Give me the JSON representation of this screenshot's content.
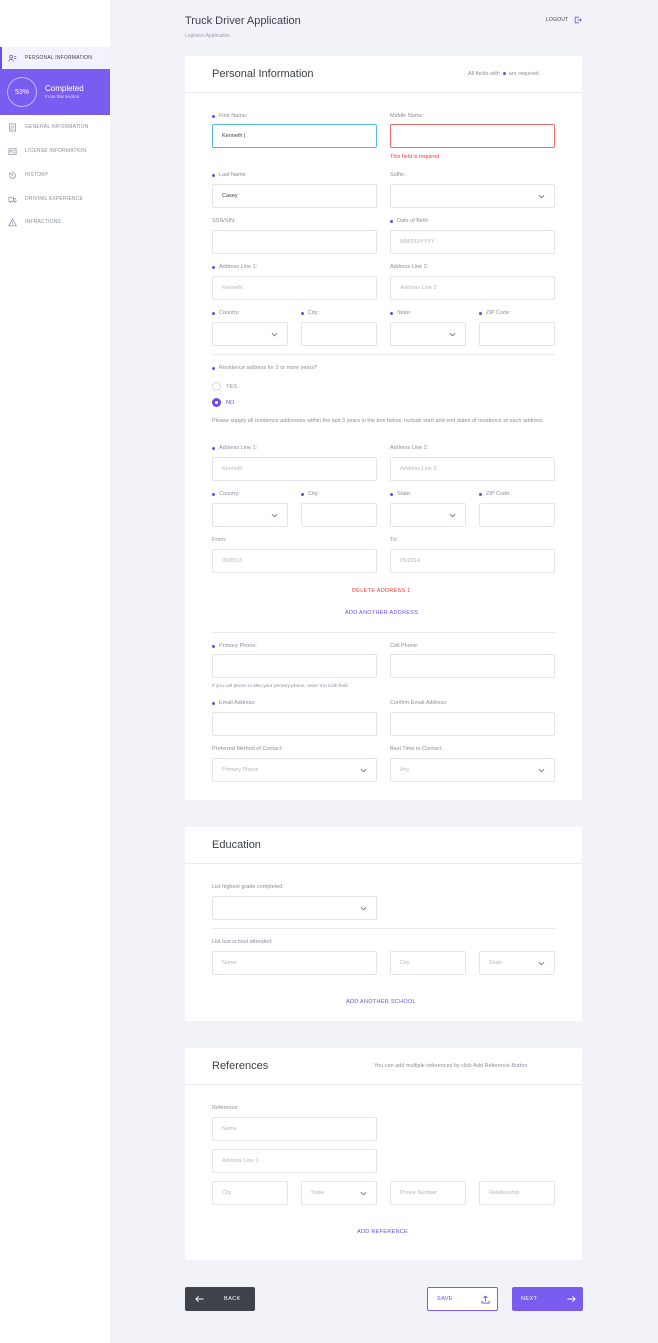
{
  "sidebar": {
    "items": [
      {
        "label": "PERSONAL INFORMATION",
        "icon": "person-card-icon"
      },
      {
        "label": "GENERAL INFORMATION",
        "icon": "document-icon"
      },
      {
        "label": "LICENSE INFORMATION",
        "icon": "license-icon"
      },
      {
        "label": "HISTORY",
        "icon": "history-icon"
      },
      {
        "label": "DRIVING EXPERIENCE",
        "icon": "truck-icon"
      },
      {
        "label": "INFRACTIONS",
        "icon": "warning-icon"
      }
    ],
    "progress": {
      "percent": "53%",
      "value": 0.53,
      "title": "Completed",
      "subtitle": "From this section"
    }
  },
  "header": {
    "title": "Truck Driver Application",
    "subtitle": "Logistics Application",
    "logout": "LOGOUT"
  },
  "personal": {
    "title": "Personal Information",
    "note_before": "All fields with",
    "note_after": "are required.",
    "first_name": {
      "label": "First Name:",
      "value": "Kenneth |"
    },
    "middle_name": {
      "label": "Middle Name:",
      "error": "This field is required."
    },
    "last_name": {
      "label": "Last Name:",
      "value": "Casey"
    },
    "suffix": {
      "label": "Suffix:"
    },
    "ssn": {
      "label": "SSN/SIN:"
    },
    "dob": {
      "label": "Date of Birth:",
      "placeholder": "MM/DD/YYYY"
    },
    "address1": {
      "label": "Address Line 1:",
      "placeholder": "Kenneth"
    },
    "address2": {
      "label": "Address Line 2:",
      "placeholder": "Address Line 2"
    },
    "country": {
      "label": "Country:"
    },
    "city": {
      "label": "City:"
    },
    "state": {
      "label": "State:"
    },
    "zip": {
      "label": "ZIP Code:"
    },
    "residence": {
      "question": "Residence address for 3 or more years?",
      "yes": "YES",
      "no": "NO",
      "selected": "NO"
    },
    "instructions": "Please supply all residence addresses within the last 3 years in the box below. Include start and end dates of residence at each address.",
    "prev_address1": {
      "label": "Address Line 1:",
      "placeholder": "Kenneth"
    },
    "prev_address2": {
      "label": "Address Line 2:",
      "placeholder": "Address Line 2"
    },
    "prev_country": {
      "label": "Country:"
    },
    "prev_city": {
      "label": "City:"
    },
    "prev_state": {
      "label": "State:"
    },
    "prev_zip": {
      "label": "ZIP Code:"
    },
    "from": {
      "label": "From:",
      "placeholder": "09/2013"
    },
    "to": {
      "label": "To:",
      "placeholder": "05/2014"
    },
    "delete_address": "DELETE ADDRESS 1",
    "add_address": "ADD ANOTHER ADDRESS",
    "primary_phone": {
      "label": "Primary Phone:"
    },
    "cell_phone": {
      "label": "Cell Phone:"
    },
    "phone_hint": "If you cell phone is also your primary phone, enter it in both field",
    "email": {
      "label": "Email Address:"
    },
    "confirm_email": {
      "label": "Confirm Email Address:"
    },
    "contact_method": {
      "label": "Preferred Method of Contact:",
      "value": "Primary Phone"
    },
    "best_time": {
      "label": "Best Time to Contact:",
      "value": "Any"
    }
  },
  "education": {
    "title": "Education",
    "grade": {
      "label": "List highest grade completed:"
    },
    "school": {
      "label": "List last school attended:",
      "name_placeholder": "Name",
      "city_placeholder": "City",
      "state_placeholder": "State"
    },
    "add_school": "ADD ANOTHER SCHOOL"
  },
  "references": {
    "title": "References",
    "note": "You can add multiple references by click Add Reference Button",
    "label": "Reference:",
    "name_placeholder": "Name",
    "address_placeholder": "Address Line 1",
    "city_placeholder": "City",
    "state_placeholder": "State",
    "phone_placeholder": "Phone Number",
    "relationship_placeholder": "Relationship",
    "add_reference": "ADD REFERENCE"
  },
  "footer": {
    "back": "BACK",
    "save": "SAVE",
    "next": "NEXT"
  },
  "colors": {
    "accent": "#7b5cf0",
    "error": "#ef3b3b",
    "focus": "#56b4e9",
    "dark_button": "#3d4348"
  }
}
